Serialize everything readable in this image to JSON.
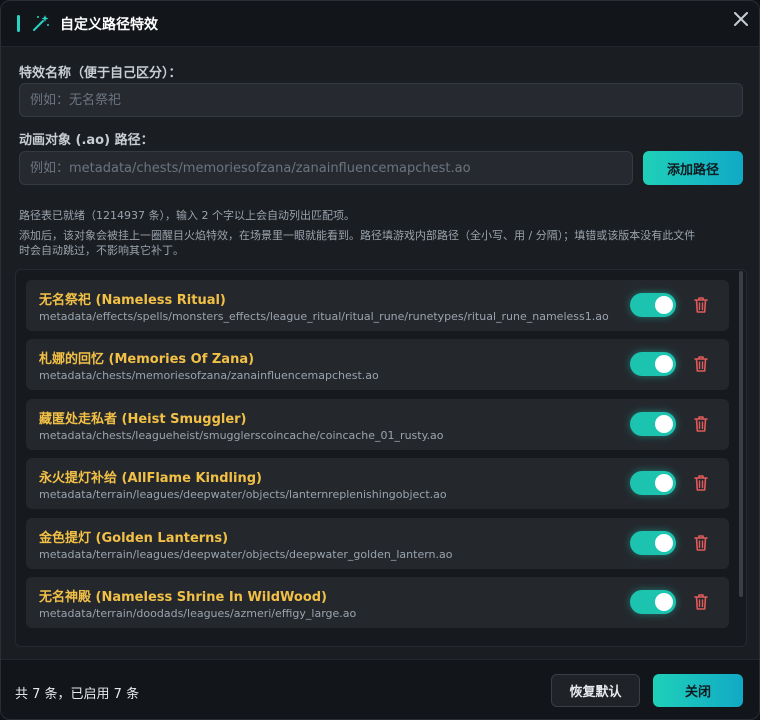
{
  "dialog": {
    "title": "自定义路径特效",
    "icons": {
      "title": "magic-wand-icon",
      "close": "close-icon"
    }
  },
  "form": {
    "name_label": "特效名称（便于自己区分）：",
    "name_placeholder": "例如：无名祭祀",
    "path_label": "动画对象 (.ao) 路径：",
    "path_placeholder": "例如：metadata/chests/memoriesofzana/zanainfluencemapchest.ao",
    "add_button": "添加路径"
  },
  "hints": {
    "status": "路径表已就绪（1214937 条），输入 2 个字以上会自动列出匹配项。",
    "description_line1": "添加后，该对象会被挂上一圈醒目火焰特效，在场景里一眼就能看到。路径填游戏内部路径（全小写、用 / 分隔）；填错或该版本没有此文件",
    "description_line2": "时会自动跳过，不影响其它补丁。"
  },
  "items": [
    {
      "title": "无名祭祀 (Nameless Ritual)",
      "path": "metadata/effects/spells/monsters_effects/league_ritual/ritual_rune/runetypes/ritual_rune_nameless1.ao",
      "enabled": true
    },
    {
      "title": "札娜的回忆 (Memories Of Zana)",
      "path": "metadata/chests/memoriesofzana/zanainfluencemapchest.ao",
      "enabled": true
    },
    {
      "title": "藏匿处走私者 (Heist Smuggler)",
      "path": "metadata/chests/leagueheist/smugglerscoincache/coincache_01_rusty.ao",
      "enabled": true
    },
    {
      "title": "永火提灯补给 (AllFlame Kindling)",
      "path": "metadata/terrain/leagues/deepwater/objects/lanternreplenishingobject.ao",
      "enabled": true
    },
    {
      "title": "金色提灯 (Golden Lanterns)",
      "path": "metadata/terrain/leagues/deepwater/objects/deepwater_golden_lantern.ao",
      "enabled": true
    },
    {
      "title": "无名神殿 (Nameless Shrine In WildWood)",
      "path": "metadata/terrain/doodads/leagues/azmeri/effigy_large.ao",
      "enabled": true
    }
  ],
  "item_icons": {
    "delete": "trash-icon"
  },
  "footer": {
    "status": "共 7 条，已启用 7 条",
    "reset_button": "恢复默认",
    "close_button": "关闭"
  },
  "colors": {
    "accent": "#1fd0b8",
    "item_title": "#f3c046",
    "delete": "#e05a5a",
    "background": "#1a1d22"
  }
}
